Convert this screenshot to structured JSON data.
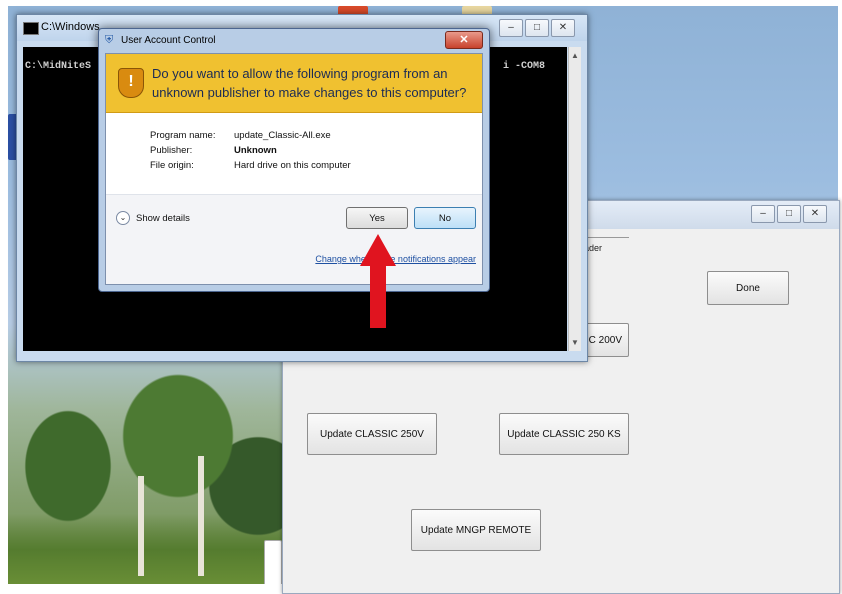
{
  "console": {
    "title": "C:\\Windows",
    "line_left": "C:\\MidNiteS",
    "line_right": "i -COM8"
  },
  "app": {
    "frame_label": "oader",
    "buttons": {
      "done": "Done",
      "classic_200v": "C 200V",
      "classic_250v": "Update CLASSIC 250V",
      "classic_250ks": "Update CLASSIC 250 KS",
      "mngp_remote": "Update MNGP REMOTE"
    }
  },
  "uac": {
    "title": "User Account Control",
    "close_glyph": "✕",
    "question": "Do you want to allow the following program from an unknown publisher to make changes to this computer?",
    "details": [
      {
        "key": "Program name:",
        "value": "update_Classic-All.exe"
      },
      {
        "key": "Publisher:",
        "value": "Unknown"
      },
      {
        "key": "File origin:",
        "value": "Hard drive on this computer"
      }
    ],
    "show_details": "Show details",
    "yes_label": "Yes",
    "no_label": "No",
    "change_link": "Change when these notifications appear"
  },
  "window_controls": {
    "minimize": "–",
    "maximize": "□",
    "close": "✕"
  },
  "colors": {
    "uac_banner": "#f0c130",
    "arrow": "#e0141f",
    "console_bg": "#000000"
  }
}
